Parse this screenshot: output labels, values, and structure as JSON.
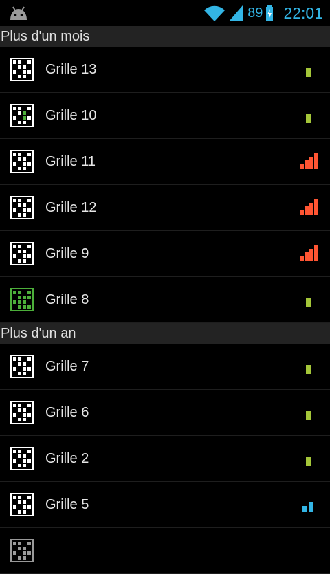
{
  "status_bar": {
    "battery_percent": "89",
    "time": "22:01",
    "accent_color": "#33b5e5"
  },
  "sections": [
    {
      "header": "Plus d'un mois",
      "items": [
        {
          "label": "Grille 13",
          "icon": "grid-white-icon",
          "difficulty": "easy"
        },
        {
          "label": "Grille 10",
          "icon": "grid-partial-green-icon",
          "difficulty": "easy"
        },
        {
          "label": "Grille 11",
          "icon": "grid-white-icon",
          "difficulty": "hard"
        },
        {
          "label": "Grille 12",
          "icon": "grid-white-icon",
          "difficulty": "hard"
        },
        {
          "label": "Grille 9",
          "icon": "grid-white-icon",
          "difficulty": "hard"
        },
        {
          "label": "Grille 8",
          "icon": "grid-green-icon",
          "difficulty": "easy"
        }
      ]
    },
    {
      "header": "Plus d'un an",
      "items": [
        {
          "label": "Grille 7",
          "icon": "grid-white-icon",
          "difficulty": "easy"
        },
        {
          "label": "Grille 6",
          "icon": "grid-white-icon",
          "difficulty": "easy"
        },
        {
          "label": "Grille 2",
          "icon": "grid-white-icon",
          "difficulty": "easy"
        },
        {
          "label": "Grille 5",
          "icon": "grid-white-icon",
          "difficulty": "medium"
        }
      ]
    }
  ],
  "colors": {
    "easy": "#a4c639",
    "medium": "#33b5e5",
    "hard": "#ff5533",
    "section_bg": "#232323"
  }
}
